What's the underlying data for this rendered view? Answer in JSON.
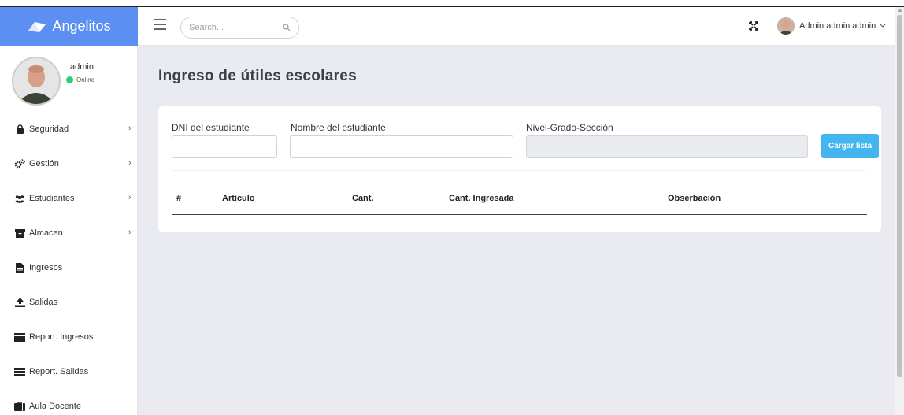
{
  "brand": {
    "name": "Angelitos"
  },
  "header": {
    "search_placeholder": "Search...",
    "user_name": "Admin admin admin"
  },
  "sidebar": {
    "profile": {
      "name": "admin",
      "status": "Online"
    },
    "items": [
      {
        "label": "Seguridad",
        "icon": "lock-icon",
        "has_submenu": true
      },
      {
        "label": "Gestión",
        "icon": "gears-icon",
        "has_submenu": true
      },
      {
        "label": "Estudiantes",
        "icon": "users-icon",
        "has_submenu": true
      },
      {
        "label": "Almacen",
        "icon": "archive-icon",
        "has_submenu": true
      },
      {
        "label": "Ingresos",
        "icon": "file-icon",
        "has_submenu": false
      },
      {
        "label": "Salidas",
        "icon": "upload-icon",
        "has_submenu": false
      },
      {
        "label": "Report. Ingresos",
        "icon": "list-icon",
        "has_submenu": false
      },
      {
        "label": "Report. Salidas",
        "icon": "list-icon",
        "has_submenu": false
      },
      {
        "label": "Aula Docente",
        "icon": "briefcase-icon",
        "has_submenu": false
      }
    ]
  },
  "main": {
    "title": "Ingreso de útiles escolares",
    "form": {
      "dni_label": "DNI del estudiante",
      "dni_value": "",
      "name_label": "Nombre del estudiante",
      "name_value": "",
      "level_label": "Nivel-Grado-Sección",
      "level_value": "",
      "load_button": "Cargar lista"
    },
    "table": {
      "headers": [
        "#",
        "Artículo",
        "Cant.",
        "Cant. Ingresada",
        "Obserbación"
      ],
      "rows": []
    }
  },
  "colors": {
    "brand": "#5b8ff2",
    "button": "#45b5f0",
    "online": "#2ecc71",
    "background": "#e9ebf0"
  }
}
